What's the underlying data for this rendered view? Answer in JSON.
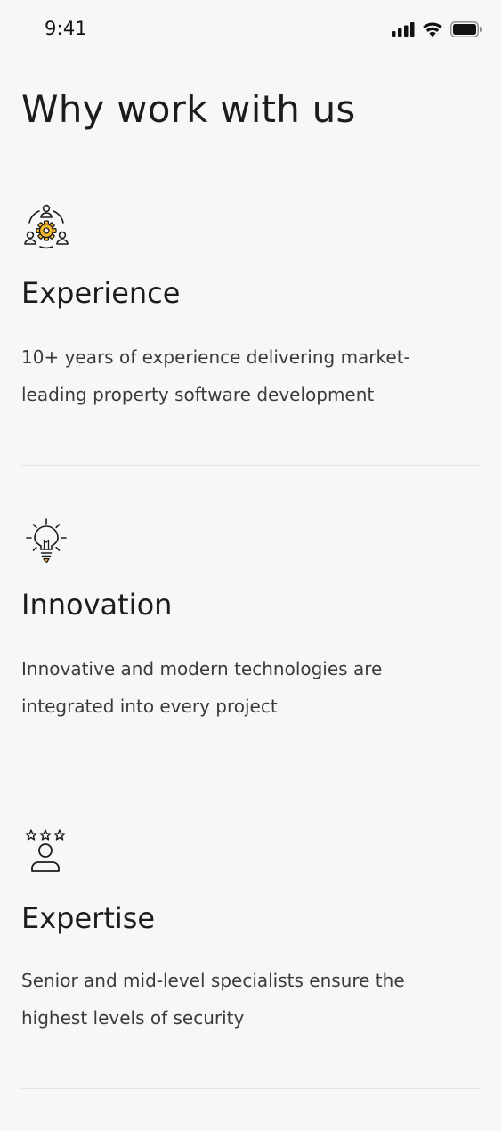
{
  "status_bar": {
    "time": "9:41"
  },
  "page": {
    "title": "Why work with us"
  },
  "features": [
    {
      "icon": "team-gear-icon",
      "title": "Experience",
      "description": "10+ years of experience delivering market-leading property software development"
    },
    {
      "icon": "lightbulb-icon",
      "title": "Innovation",
      "description": "Innovative and modern technologies are integrated into every project"
    },
    {
      "icon": "rated-expert-icon",
      "title": "Expertise",
      "description": "Senior and mid-level specialists ensure the highest levels of security"
    }
  ],
  "colors": {
    "background": "#f6f7f9",
    "accent": "#f2b92f",
    "text": "#1c1c1c",
    "divider": "#e2e4e8"
  }
}
